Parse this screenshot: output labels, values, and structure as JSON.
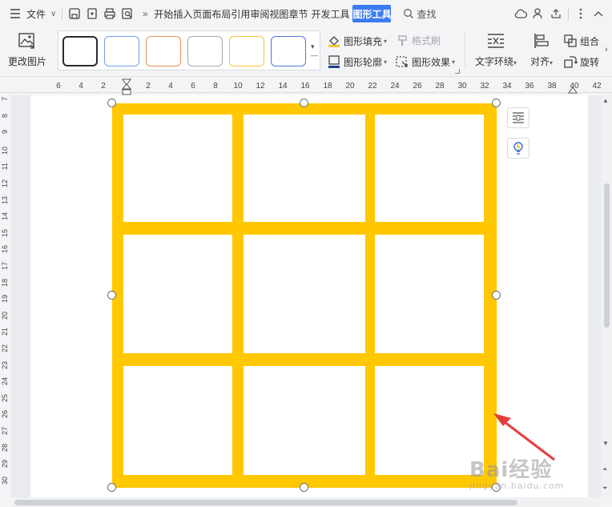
{
  "menubar": {
    "file_label": "文件",
    "tabs": [
      "开始",
      "插入",
      "页面布局",
      "引用",
      "审阅",
      "视图",
      "章节",
      "开发工具"
    ],
    "active_tab": "图形工具",
    "search_label": "查找"
  },
  "ribbon": {
    "change_picture_label": "更改图片",
    "shape_styles": [
      {
        "border": "#2b2b2b"
      },
      {
        "border": "#6fa0e6"
      },
      {
        "border": "#ef8f56"
      },
      {
        "border": "#a7a9ad"
      },
      {
        "border": "#f5c534"
      },
      {
        "border": "#4a78d8"
      }
    ],
    "shape_fill_label": "图形填充",
    "format_painter_label": "格式刷",
    "shape_outline_label": "图形轮廓",
    "shape_effects_label": "图形效果",
    "text_wrap_label": "文字环绕",
    "align_label": "对齐",
    "group_label": "组合",
    "rotate_label": "旋转"
  },
  "ruler": {
    "h_ticks": [
      "6",
      "4",
      "2",
      "2",
      "4",
      "6",
      "8",
      "10",
      "12",
      "14",
      "16",
      "18",
      "20",
      "22",
      "24",
      "26",
      "28",
      "30",
      "32",
      "34",
      "36",
      "38",
      "40",
      "42"
    ],
    "v_ticks": [
      "7",
      "8",
      "9",
      "10",
      "11",
      "12",
      "13",
      "14",
      "15",
      "16",
      "17",
      "18",
      "19",
      "20",
      "21",
      "22",
      "23",
      "24",
      "25",
      "26",
      "27",
      "28",
      "29",
      "30"
    ]
  },
  "shape": {
    "fill_color": "#ffc800",
    "rows": 3,
    "cols": 3
  },
  "watermark": {
    "brand": "Bai经验",
    "url": "jingyan.baidu.com"
  },
  "colors": {
    "accent": "#3c7cf3",
    "arrow": "#e63c3c"
  }
}
